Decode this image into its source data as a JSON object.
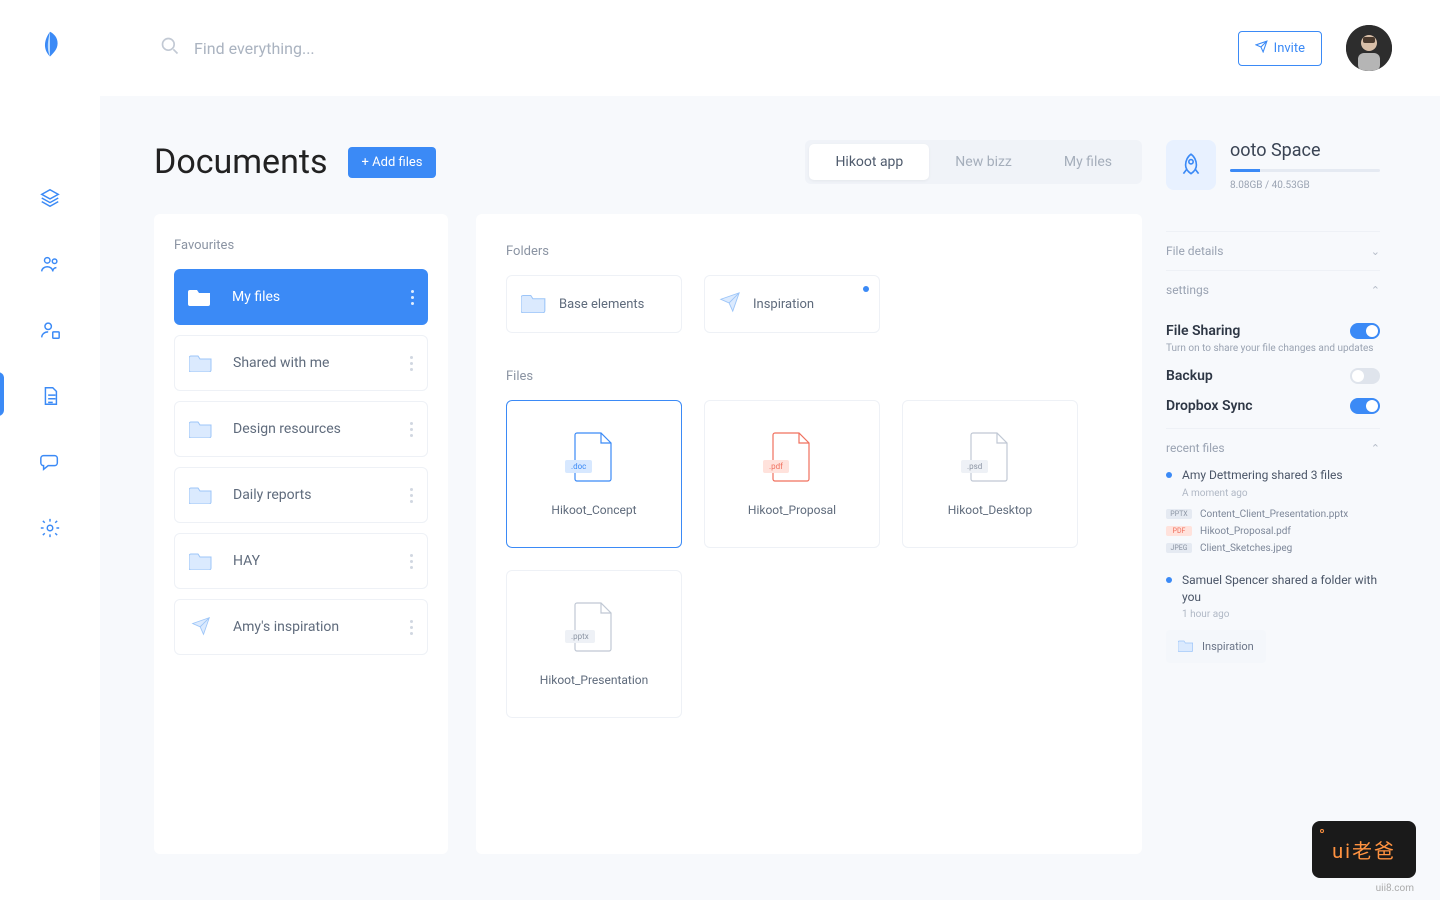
{
  "search": {
    "placeholder": "Find everything..."
  },
  "invite_label": "Invite",
  "page_title": "Documents",
  "add_files_label": "+ Add files",
  "tabs": [
    {
      "label": "Hikoot app",
      "active": true
    },
    {
      "label": "New bizz",
      "active": false
    },
    {
      "label": "My files",
      "active": false
    }
  ],
  "favourites_label": "Favourites",
  "favourites": [
    {
      "label": "My files",
      "selected": true,
      "icon": "folder"
    },
    {
      "label": "Shared with me",
      "selected": false,
      "icon": "folder"
    },
    {
      "label": "Design resources",
      "selected": false,
      "icon": "folder"
    },
    {
      "label": "Daily reports",
      "selected": false,
      "icon": "folder"
    },
    {
      "label": "HAY",
      "selected": false,
      "icon": "folder"
    },
    {
      "label": "Amy's inspiration",
      "selected": false,
      "icon": "send"
    }
  ],
  "folders_label": "Folders",
  "folders": [
    {
      "label": "Base elements",
      "notify": false
    },
    {
      "label": "Inspiration",
      "notify": true,
      "icon": "send"
    }
  ],
  "files_label": "Files",
  "files": [
    {
      "label": "Hikoot_Concept",
      "ext": ".doc",
      "color": "#3b8af6",
      "selected": true
    },
    {
      "label": "Hikoot_Proposal",
      "ext": ".pdf",
      "color": "#f0705e",
      "selected": false
    },
    {
      "label": "Hikoot_Desktop",
      "ext": ".psd",
      "color": "#c0c8d4",
      "selected": false
    },
    {
      "label": "Hikoot_Presentation",
      "ext": ".pptx",
      "color": "#c0c8d4",
      "selected": false
    }
  ],
  "space": {
    "title": "ooto Space",
    "usage": "8.08GB / 40.53GB",
    "percent": 20
  },
  "accordion": {
    "details": "File details",
    "settings": "settings",
    "recent": "recent files"
  },
  "settings": {
    "sharing": {
      "title": "File Sharing",
      "desc": "Turn on to share your file changes and updates",
      "on": true
    },
    "backup": {
      "title": "Backup",
      "on": false
    },
    "dropbox": {
      "title": "Dropbox Sync",
      "on": true
    }
  },
  "recent": [
    {
      "title": "Amy Dettmering shared 3 files",
      "time": "A moment ago",
      "files": [
        {
          "ext": "pptx",
          "name": "Content_Client_Presentation.pptx",
          "color": "#e5eaf2",
          "tc": "#8b94a3"
        },
        {
          "ext": "pdf",
          "name": "Hikoot_Proposal.pdf",
          "color": "#ffe2dc",
          "tc": "#f0705e"
        },
        {
          "ext": "jpeg",
          "name": "Client_Sketches.jpeg",
          "color": "#e5eaf2",
          "tc": "#8b94a3"
        }
      ]
    },
    {
      "title": "Samuel Spencer shared a folder with you",
      "time": "1 hour ago",
      "folder": "Inspiration"
    }
  ],
  "watermark": {
    "text": "ui老爸",
    "url": "uii8.com"
  }
}
